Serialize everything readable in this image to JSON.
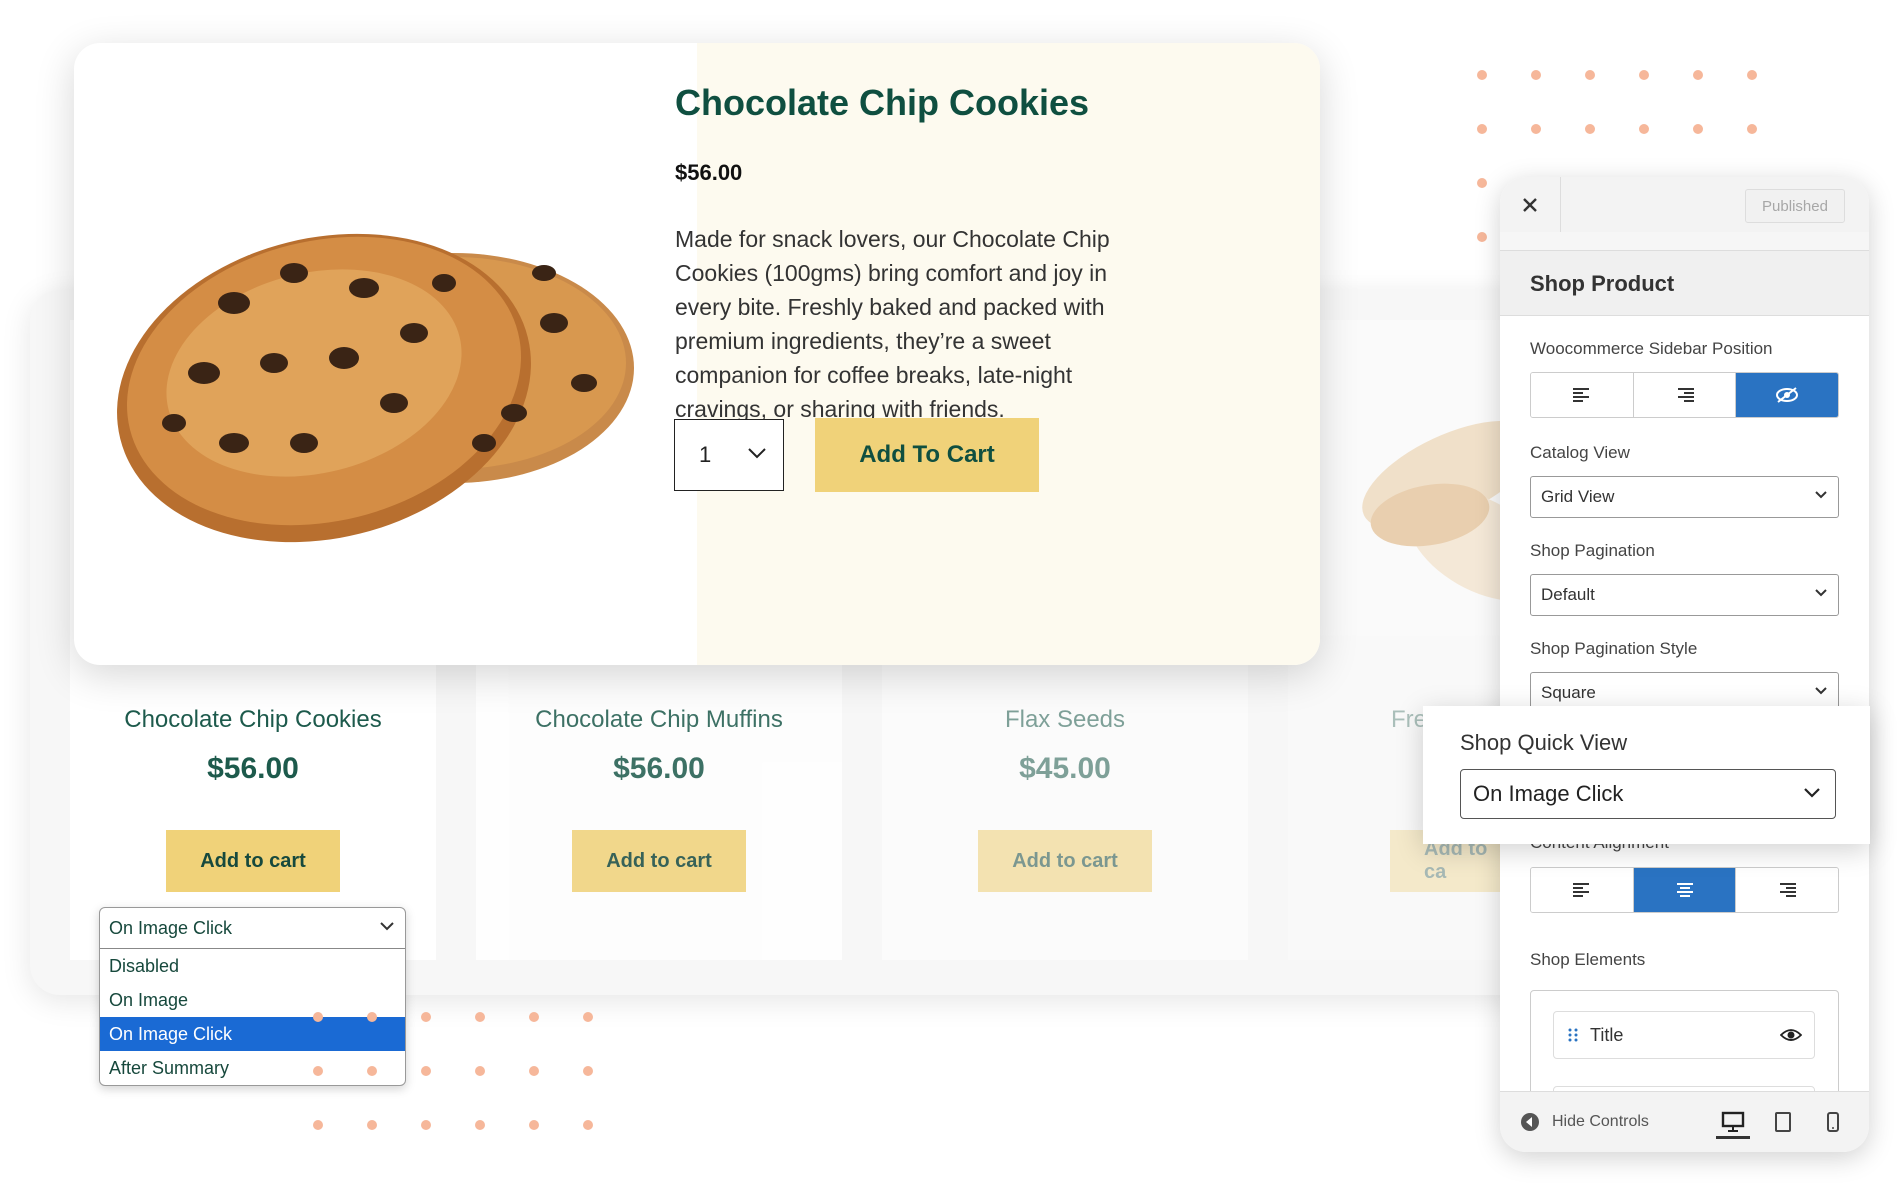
{
  "quick_view": {
    "title": "Chocolate Chip Cookies",
    "price": "$56.00",
    "description": "Made for snack lovers, our Chocolate Chip Cookies (100gms) bring comfort and joy in every bite. Freshly baked and packed with premium ingredients, they’re a sweet companion for coffee breaks, late-night cravings, or sharing with friends.",
    "quantity": "1",
    "add_to_cart": "Add To Cart"
  },
  "products": [
    {
      "title": "Chocolate Chip Cookies",
      "price": "$56.00",
      "button": "Add to cart"
    },
    {
      "title": "Chocolate Chip Muffins",
      "price": "$56.00",
      "button": "Add to cart"
    },
    {
      "title": "Flax Seeds",
      "price": "$45.00",
      "button": "Add to cart"
    },
    {
      "title": "Fre",
      "price": "",
      "button": "Add to ca"
    }
  ],
  "quick_view_dropdown": {
    "selected": "On Image Click",
    "options": [
      "Disabled",
      "On Image",
      "On Image Click",
      "After Summary"
    ]
  },
  "panel": {
    "published": "Published",
    "section_title": "Shop Product",
    "sidebar_position_label": "Woocommerce Sidebar Position",
    "catalog_view_label": "Catalog View",
    "catalog_view_value": "Grid View",
    "pagination_label": "Shop Pagination",
    "pagination_value": "Default",
    "pagination_style_label": "Shop Pagination Style",
    "pagination_style_value": "Square",
    "content_alignment_label": "Content Alignment",
    "shop_elements_label": "Shop Elements",
    "element_title": "Title",
    "hide_controls": "Hide Controls"
  },
  "shop_quick_view": {
    "label": "Shop Quick View",
    "value": "On Image Click"
  },
  "colors": {
    "accent_yellow": "#f0d279",
    "brand_green": "#0f4f40",
    "panel_blue": "#2a73c2",
    "dot_orange": "#f6b79a"
  }
}
